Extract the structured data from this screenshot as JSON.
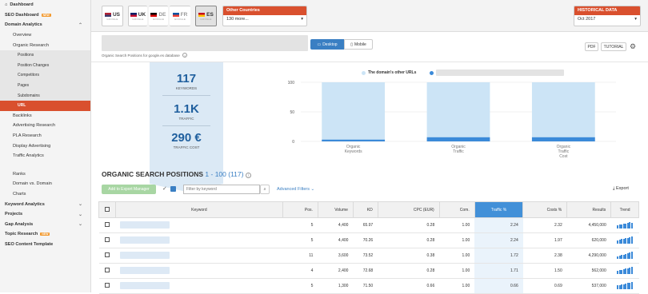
{
  "sidebar": {
    "items": [
      {
        "label": "Dashboard",
        "icon": "home-icon",
        "level": "top",
        "bold": true
      },
      {
        "label": "SEO Dashboard",
        "badge": "NEW",
        "level": "top",
        "bold": true
      },
      {
        "label": "Domain Analytics",
        "level": "top",
        "bold": true,
        "chevron": "up"
      },
      {
        "label": "Overview",
        "level": "sub"
      },
      {
        "label": "Organic Research",
        "level": "sub"
      },
      {
        "label": "Positions",
        "level": "sub2"
      },
      {
        "label": "Position Changes",
        "level": "sub2"
      },
      {
        "label": "Competitors",
        "level": "sub2"
      },
      {
        "label": "Pages",
        "level": "sub2"
      },
      {
        "label": "Subdomains",
        "level": "sub2"
      },
      {
        "label": "URL",
        "level": "sub2",
        "active": true
      },
      {
        "label": "Backlinks",
        "level": "sub"
      },
      {
        "label": "Advertising Research",
        "level": "sub"
      },
      {
        "label": "PLA Research",
        "level": "sub"
      },
      {
        "label": "Display Advertising",
        "level": "sub"
      },
      {
        "label": "Traffic Analytics",
        "level": "sub"
      },
      {
        "label": "",
        "level": "gap"
      },
      {
        "label": "Ranks",
        "level": "sub"
      },
      {
        "label": "Domain vs. Domain",
        "level": "sub"
      },
      {
        "label": "Charts",
        "level": "sub"
      },
      {
        "label": "Keyword Analytics",
        "level": "top",
        "bold": true,
        "chevron": "down"
      },
      {
        "label": "Projects",
        "level": "top",
        "bold": true,
        "chevron": "down"
      },
      {
        "label": "Gap Analysis",
        "level": "top",
        "bold": true,
        "chevron": "down"
      },
      {
        "label": "Topic Research",
        "badge": "NEW",
        "level": "top",
        "bold": true
      },
      {
        "label": "SEO Content Template",
        "level": "top",
        "bold": true
      }
    ]
  },
  "databases": [
    {
      "code": "US",
      "sub": "GOOGLE",
      "flag_colors": [
        "#b22234",
        "#3c3b6e"
      ],
      "selected": false
    },
    {
      "code": "UK",
      "sub": "GOOGLE",
      "flag_colors": [
        "#012169",
        "#c8102e"
      ],
      "selected": false
    },
    {
      "code": "DE",
      "sub": "GOOGLE",
      "flag_colors": [
        "#000000",
        "#dd0000"
      ],
      "selected": false,
      "dim": true
    },
    {
      "code": "FR",
      "sub": "GOOGLE",
      "flag_colors": [
        "#0055a4",
        "#ef4135"
      ],
      "selected": false,
      "dim": true
    },
    {
      "code": "ES",
      "sub": "GOOGLE",
      "flag_colors": [
        "#c60b1e",
        "#ffc400"
      ],
      "selected": true
    }
  ],
  "other_countries": {
    "title": "Other Countries",
    "value": "130 more..."
  },
  "historical": {
    "title": "HISTORICAL DATA",
    "value": "Oct 2017"
  },
  "filter": {
    "caption": "Organic Search Positions for google.es database",
    "desktop": "Desktop",
    "mobile": "Mobile",
    "pdf": "PDF",
    "tutorial": "TUTORIAL"
  },
  "kpis": [
    {
      "value": "117",
      "label": "KEYWORDS"
    },
    {
      "value": "1.1K",
      "label": "TRAFFIC"
    },
    {
      "value": "290 €",
      "label": "TRAFFIC COST"
    }
  ],
  "chart_data": {
    "type": "bar",
    "categories": [
      "Organic Keywords",
      "Organic Traffic",
      "Organic Traffic Cost"
    ],
    "series": [
      {
        "name": "The domain's other URLs",
        "values": [
          100,
          100,
          100
        ],
        "color": "#cce4f6"
      },
      {
        "name": "",
        "values": [
          3,
          7,
          7
        ],
        "color": "#3b8ad9"
      }
    ],
    "ylim": [
      0,
      100
    ],
    "yticks": [
      0,
      50,
      100
    ],
    "legend_label": "The domain's other URLs"
  },
  "table": {
    "title": "ORGANIC SEARCH POSITIONS",
    "range": "1 - 100 (117)",
    "export_manager": "Add to Export Manager",
    "search_placeholder": "Filter by keyword",
    "advanced": "Advanced Filters",
    "export": "Export",
    "columns": [
      "Keyword",
      "Pos.",
      "Volume",
      "KD",
      "CPC (EUR)",
      "Com.",
      "Traffic %",
      "Costs %",
      "Results",
      "Trend"
    ],
    "rows": [
      {
        "pos": "5",
        "volume": "4,400",
        "kd": "65.97",
        "cpc": "0.28",
        "com": "1.00",
        "traffic": "2.24",
        "costs": "2.32",
        "results": "4,450,000",
        "trend": [
          4,
          5,
          5,
          6,
          6,
          7,
          8,
          7
        ]
      },
      {
        "pos": "5",
        "volume": "4,400",
        "kd": "70.26",
        "cpc": "0.28",
        "com": "1.00",
        "traffic": "2.24",
        "costs": "1.97",
        "results": "620,000",
        "trend": [
          4,
          5,
          6,
          6,
          7,
          7,
          8,
          9
        ]
      },
      {
        "pos": "11",
        "volume": "3,600",
        "kd": "73.52",
        "cpc": "0.38",
        "com": "1.00",
        "traffic": "1.72",
        "costs": "2.38",
        "results": "4,290,000",
        "trend": [
          3,
          4,
          5,
          5,
          6,
          7,
          8,
          9
        ]
      },
      {
        "pos": "4",
        "volume": "2,400",
        "kd": "72.68",
        "cpc": "0.28",
        "com": "1.00",
        "traffic": "1.71",
        "costs": "1.50",
        "results": "562,000",
        "trend": [
          4,
          5,
          5,
          6,
          7,
          7,
          8,
          9
        ]
      },
      {
        "pos": "5",
        "volume": "1,300",
        "kd": "71.50",
        "cpc": "0.66",
        "com": "1.00",
        "traffic": "0.66",
        "costs": "0.69",
        "results": "537,000",
        "trend": [
          5,
          5,
          6,
          6,
          7,
          8,
          8,
          9
        ]
      }
    ]
  }
}
